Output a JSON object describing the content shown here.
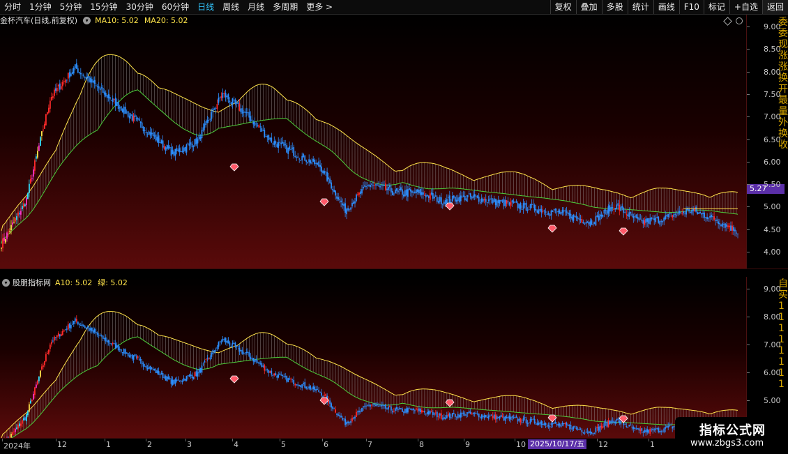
{
  "toolbar": {
    "periods": [
      "分时",
      "1分钟",
      "5分钟",
      "15分钟",
      "30分钟",
      "60分钟",
      "日线",
      "周线",
      "月线",
      "多周期",
      "更多 >"
    ],
    "active_period": "日线",
    "right_buttons": [
      "复权",
      "叠加",
      "多股",
      "统计",
      "画线",
      "F10",
      "标记",
      "+自选",
      "返回"
    ]
  },
  "pane1": {
    "title": "金杯汽车(日线,前复权)",
    "ma1_label": "MA10: 5.02",
    "ma2_label": "MA20: 5.02"
  },
  "pane2": {
    "title": "股朋指标网",
    "ma1_label": "A10: 5.02",
    "ma2_label": "绿: 5.02"
  },
  "axis1": {
    "ticks": [
      "9.00",
      "8.50",
      "8.00",
      "7.50",
      "7.00",
      "6.50",
      "6.00",
      "5.50",
      "5.00",
      "4.50",
      "4.00"
    ],
    "current_price": "5.27"
  },
  "axis2": {
    "ticks": [
      "9.00",
      "8.00",
      "7.00",
      "6.00",
      "5.00"
    ]
  },
  "side_text1": "委\n委\n现\n涨\n涨\n换\n开\n最\n量\n外\n换\n收",
  "side_text2": "自\n买\n1\n1\n1\n1\n1\n1\n1\n1",
  "xaxis": {
    "labels": [
      "2024年",
      "12",
      "1",
      "2",
      "3",
      "4",
      "5",
      "6",
      "7",
      "8",
      "9",
      "10",
      "12",
      "1"
    ],
    "cursor_date": "2025/10/17/五"
  },
  "watermark": {
    "title": "指标公式网",
    "url": "www.zbgs3.com"
  },
  "colors": {
    "bull": "#ff2a2a",
    "bear": "#2b8fff",
    "yellow": "#ffe34a",
    "green_band": "#4cd03c",
    "cyan": "#30e0ff",
    "magenta": "#ff33cc",
    "purple_tag": "#5b2fa8"
  },
  "chart_data": {
    "type": "candlestick",
    "ylim": [
      4.0,
      9.0
    ],
    "ma10_last": 5.02,
    "ma20_last": 5.02,
    "current_price": 5.27,
    "markers": "red diamond buy signals",
    "close_trend": [
      4.2,
      5.2,
      7.6,
      8.3,
      7.8,
      7.3,
      6.8,
      6.3,
      6.6,
      7.7,
      7.2,
      6.6,
      6.3,
      6.0,
      5.0,
      5.6,
      5.4,
      5.4,
      5.2,
      5.3,
      5.2,
      5.1,
      5.0,
      4.9,
      4.7,
      5.1,
      4.7,
      4.8,
      5.0,
      4.8,
      4.5
    ]
  }
}
